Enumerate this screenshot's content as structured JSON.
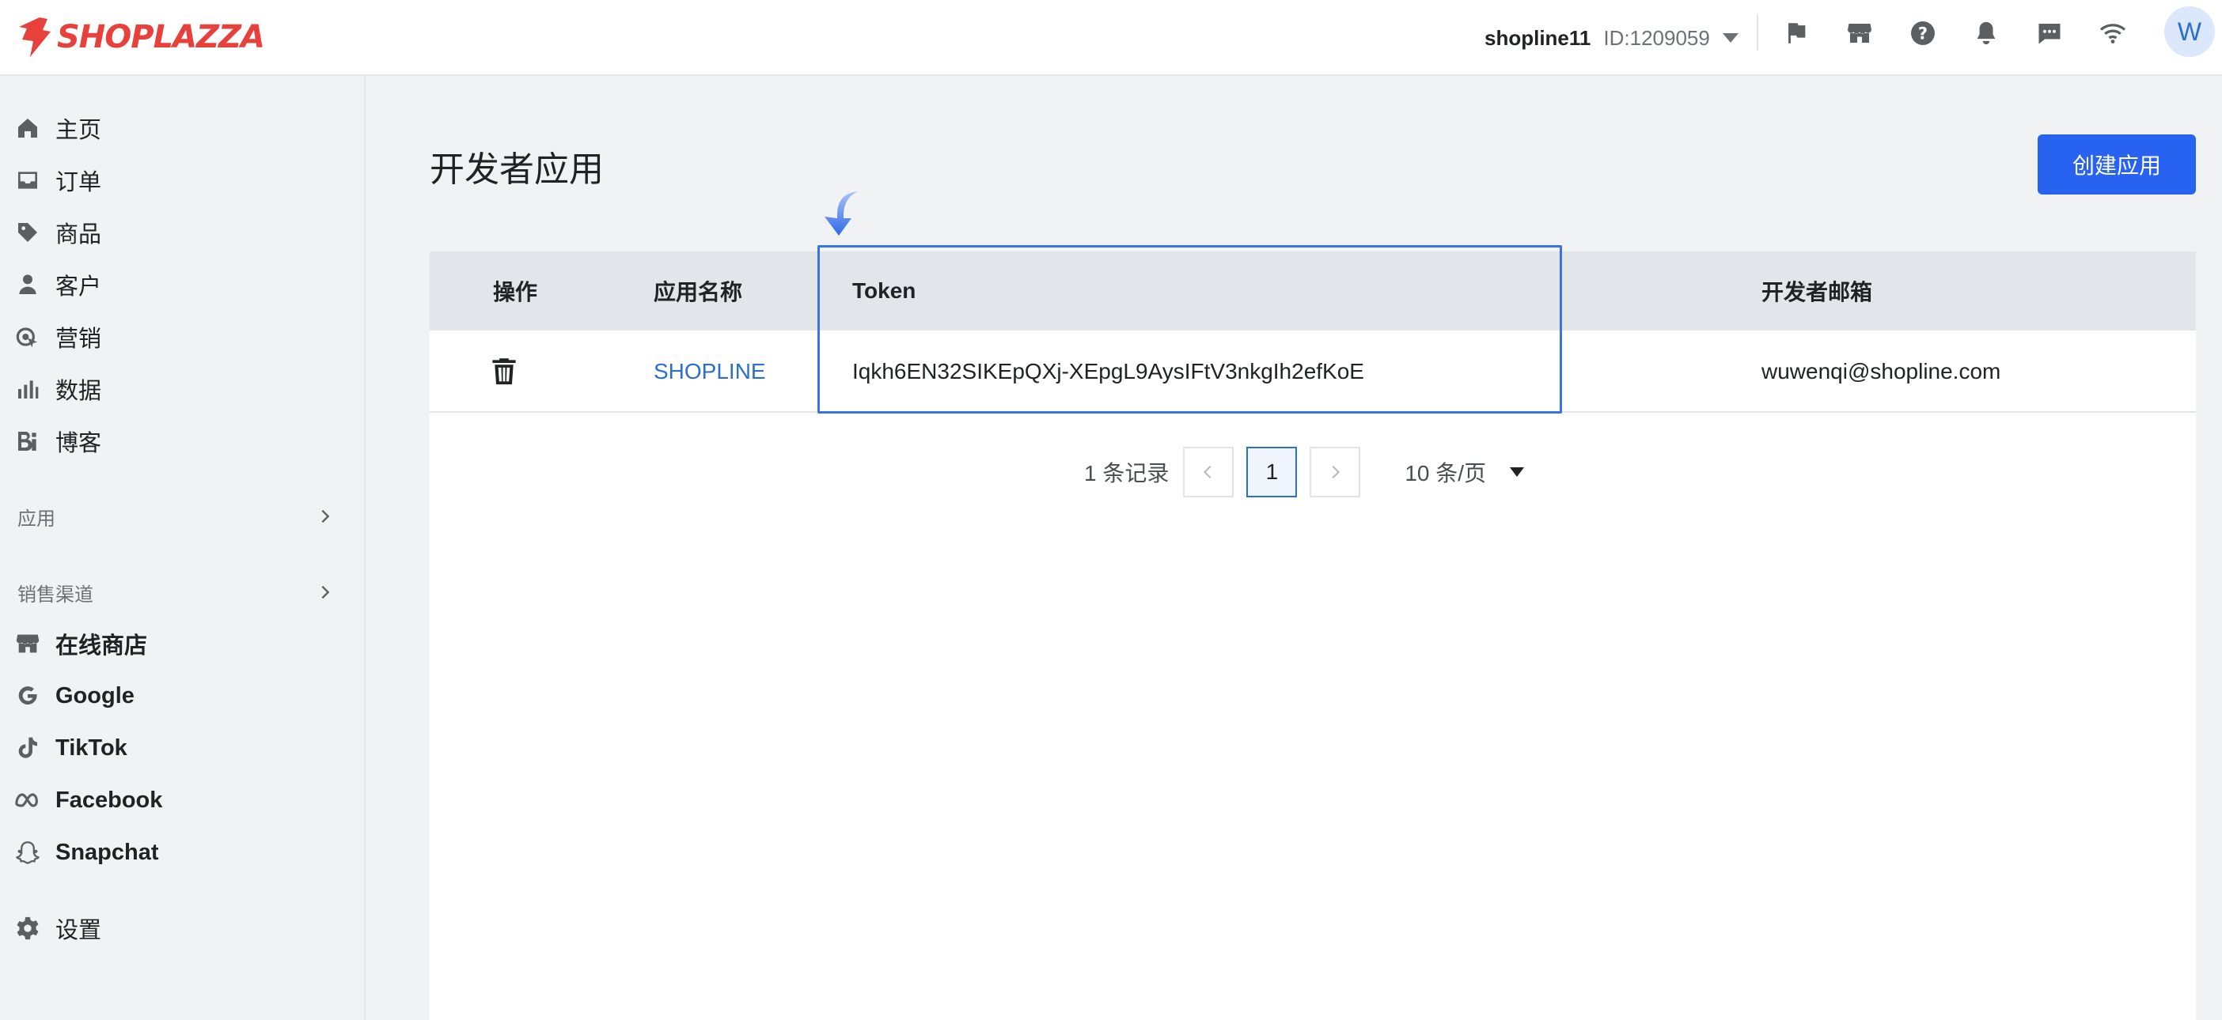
{
  "brand": {
    "name": "SHOPLAZZA",
    "color": "#e8403b"
  },
  "header": {
    "shop_name": "shopline11",
    "shop_id": "ID:1209059",
    "avatar_letter": "W",
    "icons": [
      "flag-icon",
      "store-icon",
      "help-icon",
      "bell-icon",
      "message-icon",
      "wifi-icon"
    ]
  },
  "sidebar": {
    "items": [
      {
        "label": "主页",
        "icon": "home-icon"
      },
      {
        "label": "订单",
        "icon": "inbox-icon"
      },
      {
        "label": "商品",
        "icon": "tag-icon"
      },
      {
        "label": "客户",
        "icon": "person-icon"
      },
      {
        "label": "营销",
        "icon": "marketing-icon"
      },
      {
        "label": "数据",
        "icon": "bar-chart-icon"
      },
      {
        "label": "博客",
        "icon": "blog-icon"
      }
    ],
    "apps_section": "应用",
    "channels_section": "销售渠道",
    "channels": [
      {
        "label": "在线商店",
        "icon": "store-icon"
      },
      {
        "label": "Google",
        "icon": "google-icon"
      },
      {
        "label": "TikTok",
        "icon": "tiktok-icon"
      },
      {
        "label": "Facebook",
        "icon": "meta-icon"
      },
      {
        "label": "Snapchat",
        "icon": "snapchat-icon"
      }
    ],
    "settings": {
      "label": "设置",
      "icon": "gear-icon"
    }
  },
  "main": {
    "title": "开发者应用",
    "create_button": "创建应用",
    "table": {
      "columns": [
        "操作",
        "应用名称",
        "Token",
        "开发者邮箱"
      ],
      "rows": [
        {
          "app_name": "SHOPLINE",
          "token": "Iqkh6EN32SIKEpQXj-XEpgL9AysIFtV3nkgIh2efKoE",
          "email": "wuwenqi@shopline.com"
        }
      ]
    },
    "pagination": {
      "records": "1 条记录",
      "prev": "<",
      "current": "1",
      "next": ">",
      "page_size": "10 条/页"
    }
  },
  "colors": {
    "accent": "#2862f0",
    "link": "#2c6ecb",
    "highlight": "#3a72e8"
  }
}
